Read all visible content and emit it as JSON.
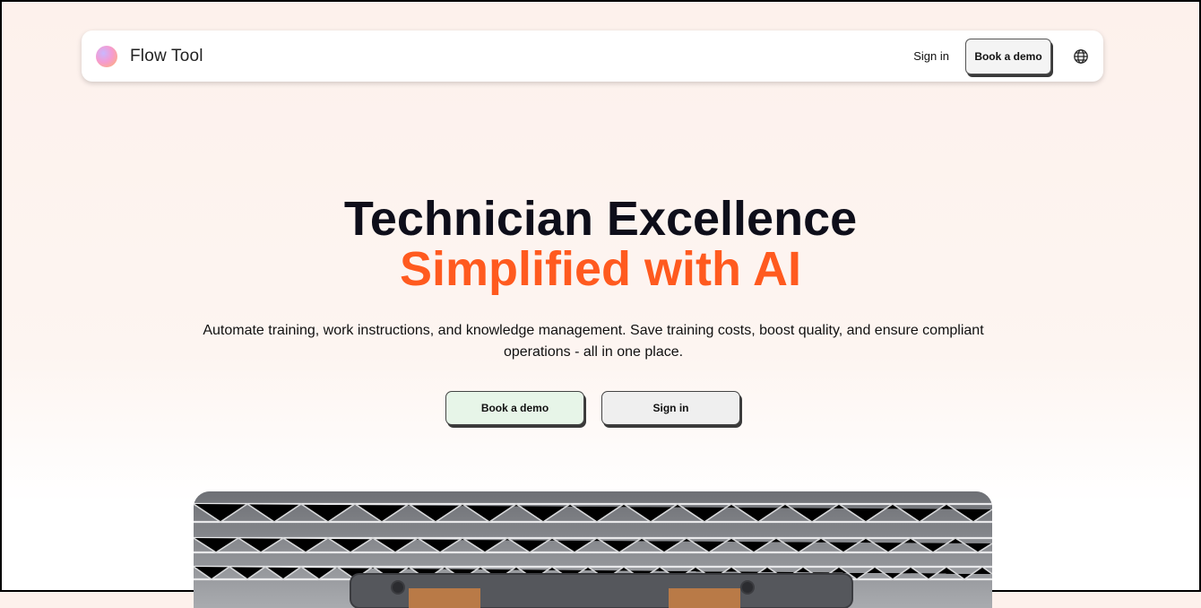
{
  "header": {
    "brand": "Flow Tool",
    "sign_in_label": "Sign in",
    "book_demo_label": "Book a demo",
    "language_icon": "globe-icon",
    "logo_icon": "flow-tool-logo"
  },
  "hero": {
    "title_line1": "Technician Excellence",
    "title_line2": "Simplified with AI",
    "subtitle": "Automate training, work instructions, and knowledge management. Save training costs, boost quality, and ensure compliant operations - all in one place.",
    "primary_cta": "Book a demo",
    "secondary_cta": "Sign in",
    "accent_color": "#ff5a1f"
  },
  "hero_image": {
    "description_icon": "factory-ceiling-image"
  }
}
